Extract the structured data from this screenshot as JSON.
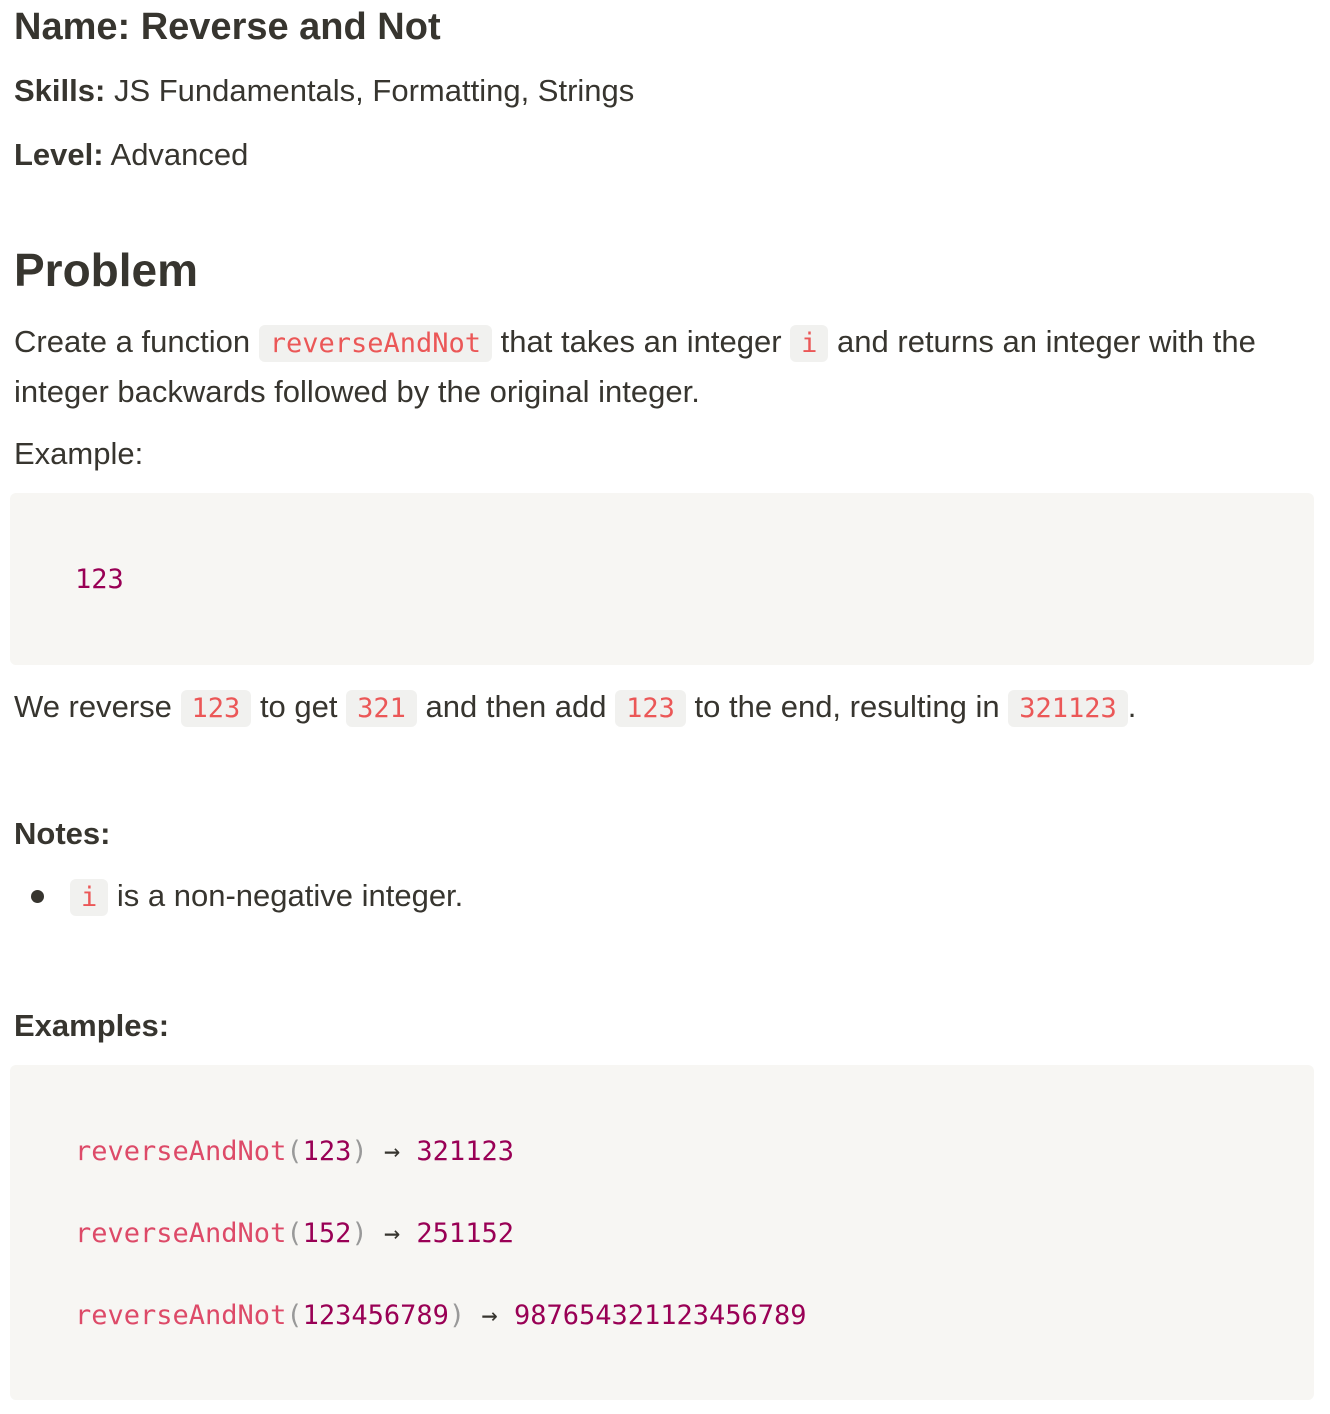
{
  "meta": {
    "name_label": "Name:",
    "name_value": "Reverse and Not",
    "skills_label": "Skills:",
    "skills_value": "JS Fundamentals, Formatting, Strings",
    "level_label": "Level:",
    "level_value": "Advanced"
  },
  "problem": {
    "heading": "Problem",
    "desc_p1": "Create a function ",
    "desc_code1": "reverseAndNot",
    "desc_p2": " that takes an integer ",
    "desc_code2": "i",
    "desc_p3": " and returns an integer with the integer backwards followed by the original integer.",
    "example_label": "Example:",
    "example_code": "123",
    "explain_p1": "We reverse ",
    "explain_c1": "123",
    "explain_p2": " to get ",
    "explain_c2": "321",
    "explain_p3": " and then add ",
    "explain_c3": "123",
    "explain_p4": " to the end, resulting in ",
    "explain_c4": "321123",
    "explain_p5": "."
  },
  "notes": {
    "heading": "Notes:",
    "items": [
      {
        "code": "i",
        "text": " is a non-negative integer."
      }
    ]
  },
  "examples": {
    "heading": "Examples:",
    "lines": [
      {
        "fn": "reverseAndNot",
        "open": "(",
        "arg": "123",
        "close": ")",
        "arrow": " → ",
        "result": "321123"
      },
      {
        "fn": "reverseAndNot",
        "open": "(",
        "arg": "152",
        "close": ")",
        "arrow": " → ",
        "result": "251152"
      },
      {
        "fn": "reverseAndNot",
        "open": "(",
        "arg": "123456789",
        "close": ")",
        "arrow": " → ",
        "result": "987654321123456789"
      }
    ]
  }
}
